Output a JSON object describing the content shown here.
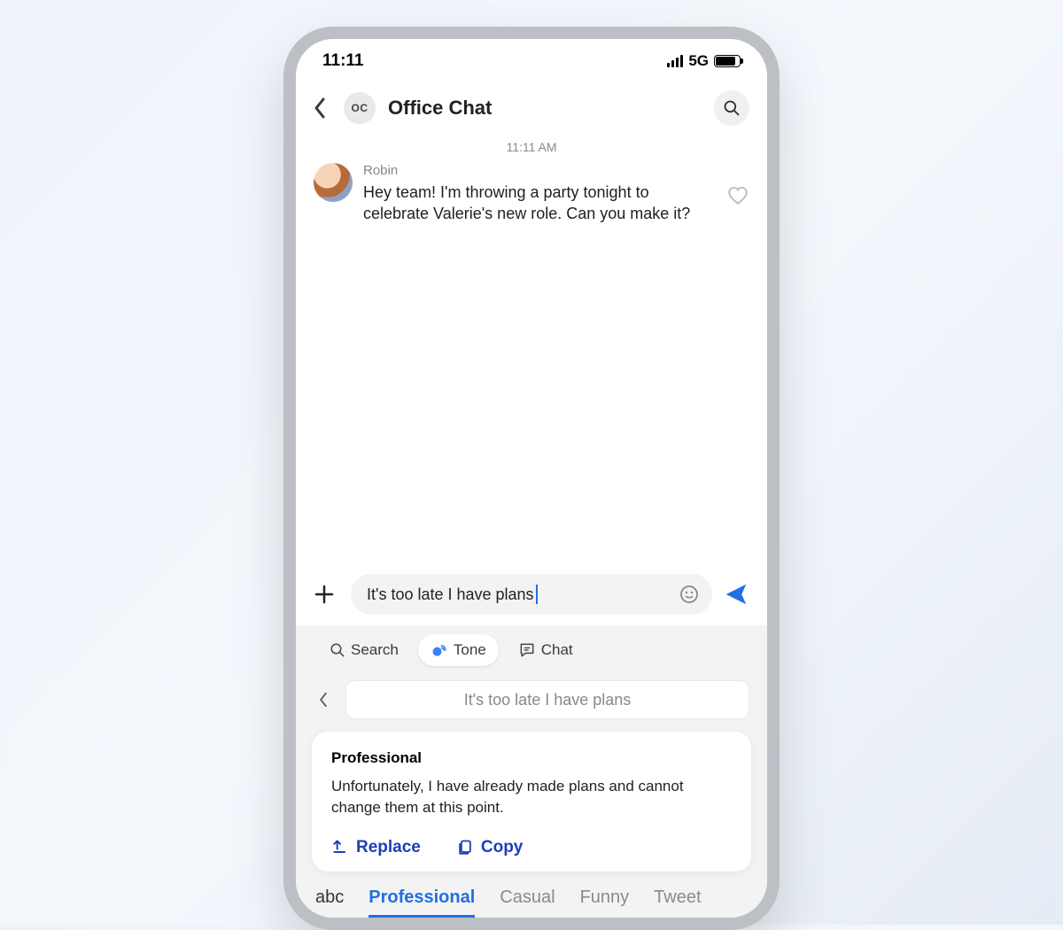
{
  "status_bar": {
    "time": "11:11",
    "network_type": "5G"
  },
  "header": {
    "badge_text": "OC",
    "title": "Office Chat"
  },
  "conversation": {
    "timestamp": "11:11 AM",
    "messages": [
      {
        "sender": "Robin",
        "text": "Hey team! I'm throwing a party tonight to celebrate Valerie's new role. Can you make it?"
      }
    ]
  },
  "composer": {
    "draft_text": "It's too late I have plans"
  },
  "ai_tools": {
    "search_label": "Search",
    "tone_label": "Tone",
    "chat_label": "Chat",
    "active": "tone"
  },
  "tone_panel": {
    "echo_text": "It's too late I have plans",
    "suggestion": {
      "title": "Professional",
      "body": "Unfortunately, I have already made plans and cannot change them at this point.",
      "replace_label": "Replace",
      "copy_label": "Copy"
    }
  },
  "keyboard_tabs": {
    "mode_label": "abc",
    "tabs": [
      "Professional",
      "Casual",
      "Funny",
      "Tweet"
    ],
    "active_index": 0
  }
}
